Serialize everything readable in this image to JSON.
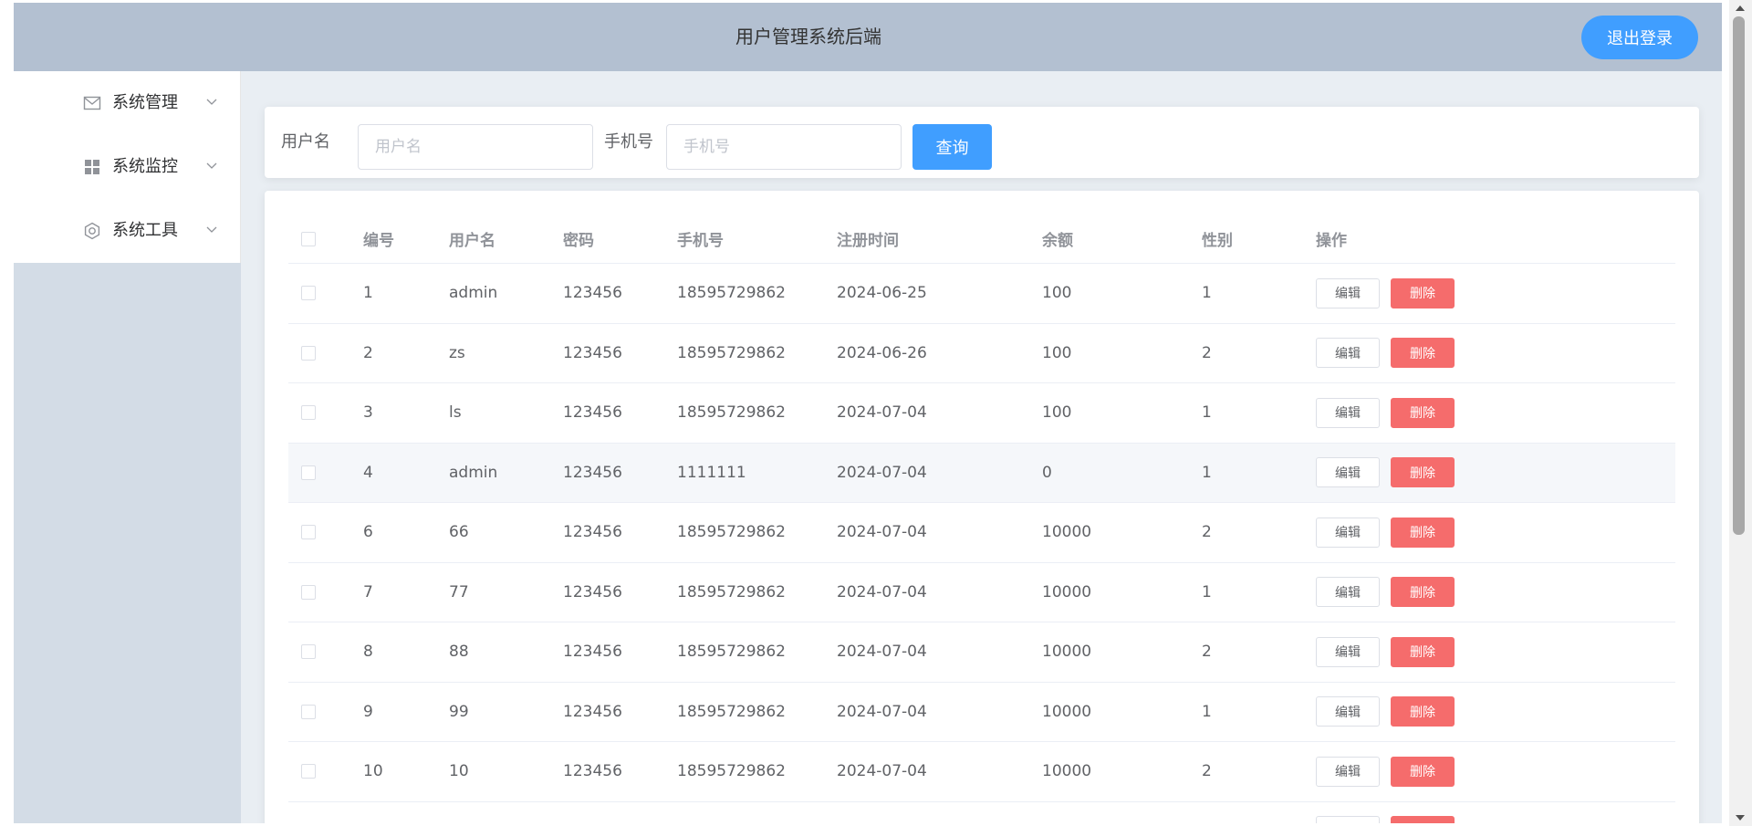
{
  "header": {
    "title": "用户管理系统后端",
    "logout_label": "退出登录"
  },
  "sidebar": {
    "items": [
      {
        "label": "系统管理",
        "icon": "message-icon"
      },
      {
        "label": "系统监控",
        "icon": "grid-icon"
      },
      {
        "label": "系统工具",
        "icon": "setting-icon"
      }
    ]
  },
  "search": {
    "username_label": "用户名",
    "username_placeholder": "用户名",
    "username_value": "",
    "phone_label": "手机号",
    "phone_placeholder": "手机号",
    "phone_value": "",
    "query_label": "查询"
  },
  "table": {
    "columns": [
      "编号",
      "用户名",
      "密码",
      "手机号",
      "注册时间",
      "余额",
      "性别",
      "操作"
    ],
    "edit_label": "编辑",
    "delete_label": "删除",
    "rows": [
      {
        "id": "1",
        "username": "admin",
        "password": "123456",
        "phone": "18595729862",
        "reg_time": "2024-06-25",
        "balance": "100",
        "gender": "1"
      },
      {
        "id": "2",
        "username": "zs",
        "password": "123456",
        "phone": "18595729862",
        "reg_time": "2024-06-26",
        "balance": "100",
        "gender": "2"
      },
      {
        "id": "3",
        "username": "ls",
        "password": "123456",
        "phone": "18595729862",
        "reg_time": "2024-07-04",
        "balance": "100",
        "gender": "1"
      },
      {
        "id": "4",
        "username": "admin",
        "password": "123456",
        "phone": "1111111",
        "reg_time": "2024-07-04",
        "balance": "0",
        "gender": "1",
        "hover": true
      },
      {
        "id": "6",
        "username": "66",
        "password": "123456",
        "phone": "18595729862",
        "reg_time": "2024-07-04",
        "balance": "10000",
        "gender": "2"
      },
      {
        "id": "7",
        "username": "77",
        "password": "123456",
        "phone": "18595729862",
        "reg_time": "2024-07-04",
        "balance": "10000",
        "gender": "1"
      },
      {
        "id": "8",
        "username": "88",
        "password": "123456",
        "phone": "18595729862",
        "reg_time": "2024-07-04",
        "balance": "10000",
        "gender": "2"
      },
      {
        "id": "9",
        "username": "99",
        "password": "123456",
        "phone": "18595729862",
        "reg_time": "2024-07-04",
        "balance": "10000",
        "gender": "1"
      },
      {
        "id": "10",
        "username": "10",
        "password": "123456",
        "phone": "18595729862",
        "reg_time": "2024-07-04",
        "balance": "10000",
        "gender": "2"
      }
    ]
  }
}
